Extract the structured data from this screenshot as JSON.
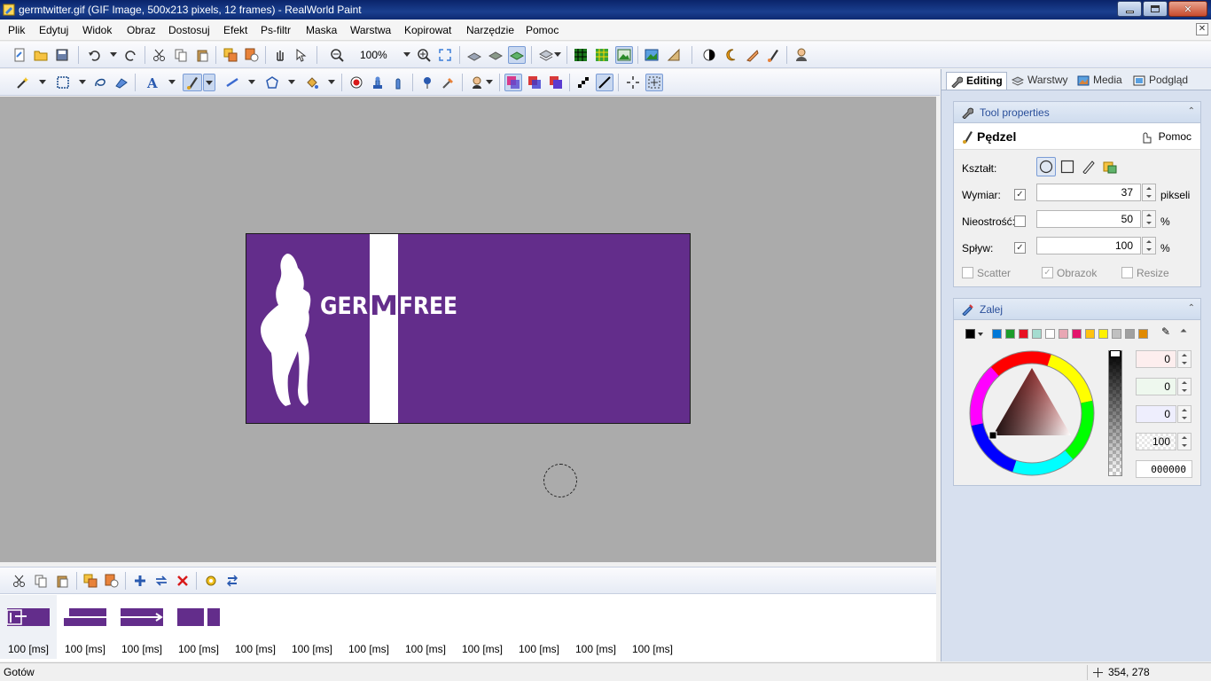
{
  "window": {
    "title": "germtwitter.gif (GIF Image, 500x213 pixels, 12 frames) - RealWorld Paint"
  },
  "menu": [
    "Plik",
    "Edytuj",
    "Widok",
    "Obraz",
    "Dostosuj",
    "Efekt",
    "Ps-filtr",
    "Maska",
    "Warstwa",
    "Kopirowat",
    "Narzędzie",
    "Pomoc"
  ],
  "toolbar": {
    "zoom": "100%"
  },
  "canvas": {
    "image_bg": "#632d8b",
    "logo_left": "GER",
    "logo_mid": "M",
    "logo_right": "FREE"
  },
  "frames": [
    {
      "delay": "100 [ms]"
    },
    {
      "delay": "100 [ms]"
    },
    {
      "delay": "100 [ms]"
    },
    {
      "delay": "100 [ms]"
    },
    {
      "delay": "100 [ms]"
    },
    {
      "delay": "100 [ms]"
    },
    {
      "delay": "100 [ms]"
    },
    {
      "delay": "100 [ms]"
    },
    {
      "delay": "100 [ms]"
    },
    {
      "delay": "100 [ms]"
    },
    {
      "delay": "100 [ms]"
    },
    {
      "delay": "100 [ms]"
    }
  ],
  "tabs": [
    "Editing",
    "Warstwy",
    "Media",
    "Podgląd"
  ],
  "tool_properties": {
    "header": "Tool properties",
    "tool_name": "Pędzel",
    "help": "Pomoc",
    "shape_label": "Kształt:",
    "size": {
      "label": "Wymiar:",
      "checked": true,
      "value": "37",
      "unit": "pikseli"
    },
    "blur": {
      "label": "Nieostrość:",
      "checked": false,
      "value": "50",
      "unit": "%"
    },
    "flow": {
      "label": "Spływ:",
      "checked": true,
      "value": "100",
      "unit": "%"
    },
    "options": [
      {
        "label": "Scatter",
        "checked": false
      },
      {
        "label": "Obrazok",
        "checked": true
      },
      {
        "label": "Resize",
        "checked": false
      }
    ]
  },
  "fill": {
    "header": "Zalej",
    "palette": [
      "#0078d7",
      "#1c9d2a",
      "#e81123",
      "#a5dcd0",
      "#ffffff",
      "#e8a7b4",
      "#e3126b",
      "#ffc20e",
      "#fff200",
      "#c0c0c0",
      "#a0a0a0",
      "#e08a00"
    ],
    "r": "0",
    "g": "0",
    "b": "0",
    "alpha": "100",
    "hex": "000000"
  },
  "status": {
    "text": "Gotów",
    "coords": "354, 278"
  }
}
